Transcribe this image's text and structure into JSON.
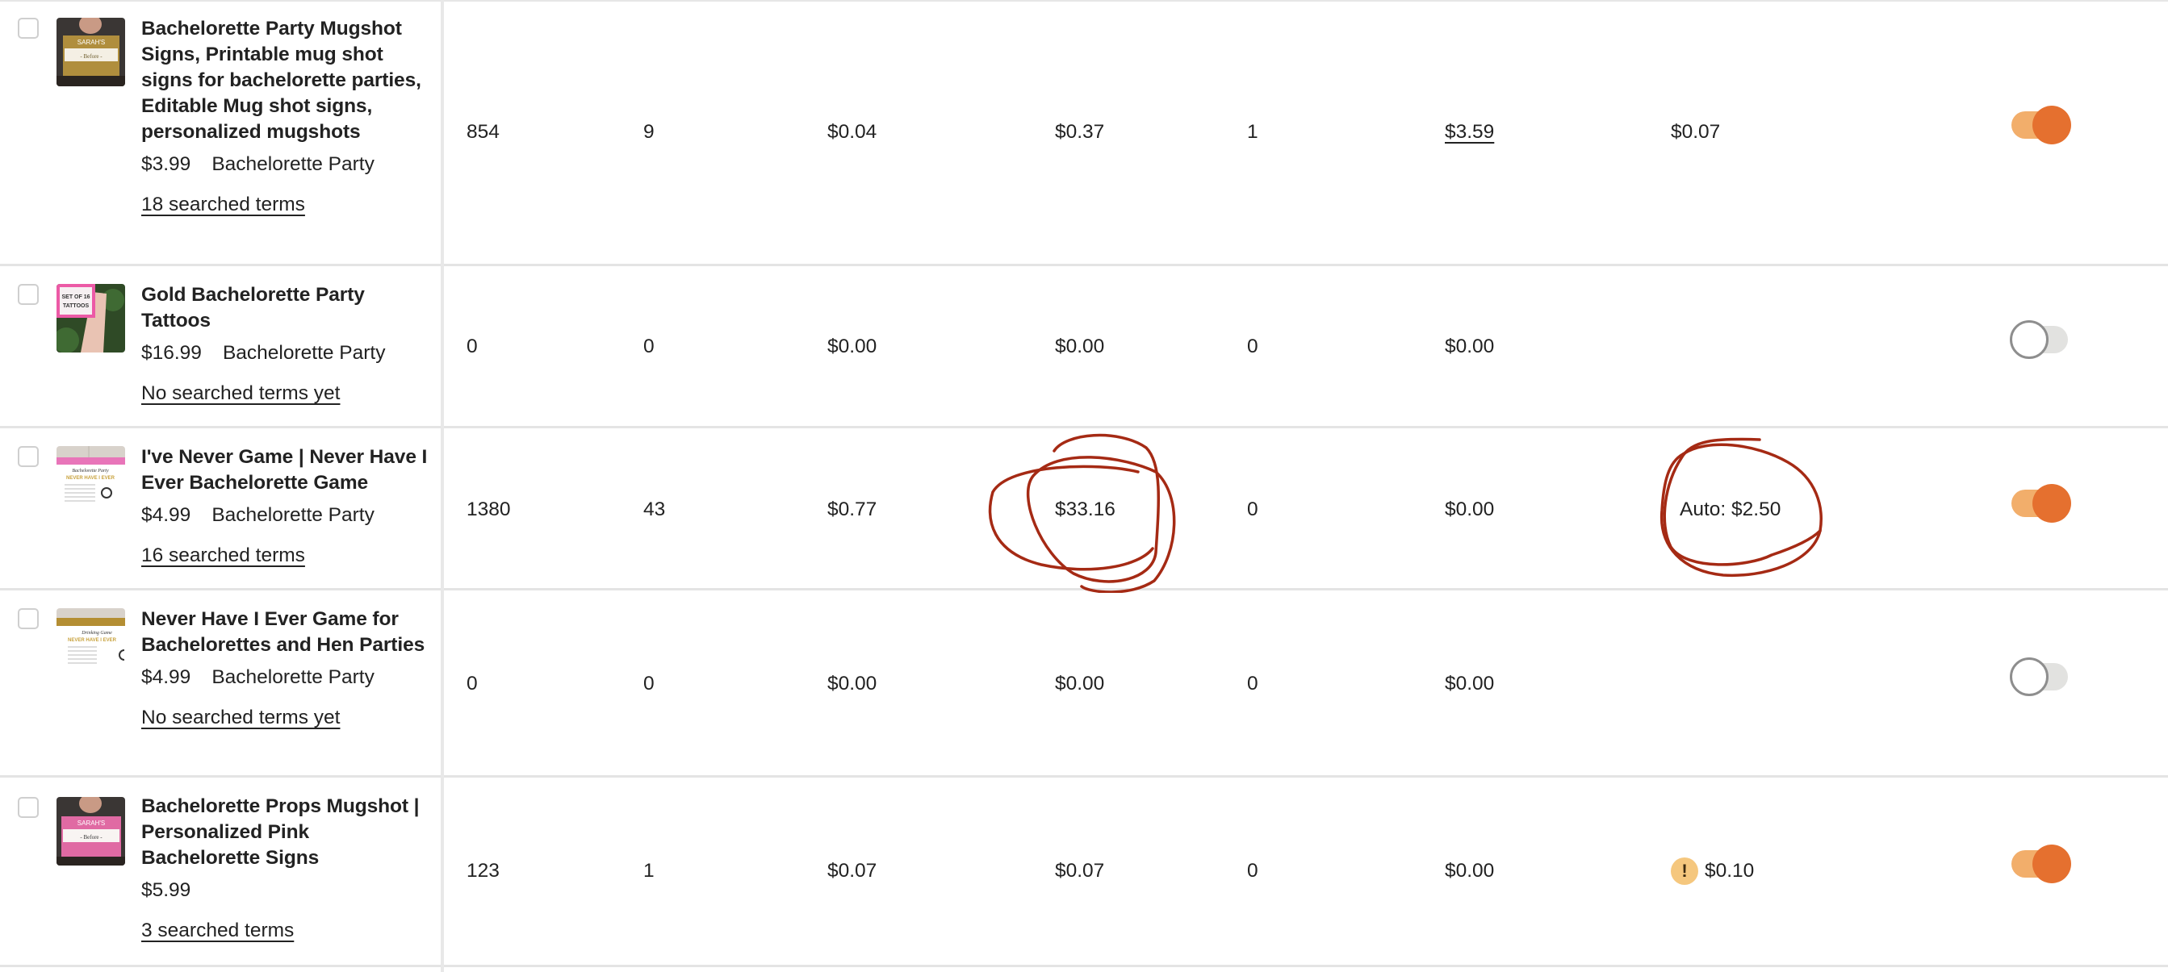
{
  "colors": {
    "toggle_on_track": "#f2ae6b",
    "toggle_on_knob": "#e5702f",
    "toggle_off_track": "#e2e2e0",
    "annotation": "#a52a14",
    "warning_badge": "#f5c77e"
  },
  "listings": [
    {
      "title": "Bachelorette Party Mugshot Signs, Printable mug shot signs for bachelorette parties, Editable Mug shot signs, personalized mugshots",
      "price": "$3.99",
      "section": "Bachelorette Party",
      "searched_terms": "18 searched terms",
      "thumb_icon": "mugshot-sign-gold-thumbnail",
      "views": "854",
      "clicks": "9",
      "col3": "$0.04",
      "col4": "$0.37",
      "orders": "1",
      "revenue": "$3.59",
      "bid": "$0.07",
      "bid_warning": false,
      "active": true
    },
    {
      "title": "Gold Bachelorette Party Tattoos",
      "price": "$16.99",
      "section": "Bachelorette Party",
      "searched_terms": "No searched terms yet",
      "thumb_icon": "tattoos-thumbnail",
      "views": "0",
      "clicks": "0",
      "col3": "$0.00",
      "col4": "$0.00",
      "orders": "0",
      "revenue": "$0.00",
      "bid": "",
      "bid_warning": false,
      "active": false
    },
    {
      "title": "I've Never Game | Never Have I Ever Bachelorette Game",
      "price": "$4.99",
      "section": "Bachelorette Party",
      "searched_terms": "16 searched terms",
      "thumb_icon": "never-have-i-ever-pink-thumbnail",
      "views": "1380",
      "clicks": "43",
      "col3": "$0.77",
      "col4": "$33.16",
      "orders": "0",
      "revenue": "$0.00",
      "bid": "Auto: $2.50",
      "bid_warning": false,
      "active": true
    },
    {
      "title": "Never Have I Ever Game for Bachelorettes and Hen Parties",
      "price": "$4.99",
      "section": "Bachelorette Party",
      "searched_terms": "No searched terms yet",
      "thumb_icon": "never-have-i-ever-gold-thumbnail",
      "views": "0",
      "clicks": "0",
      "col3": "$0.00",
      "col4": "$0.00",
      "orders": "0",
      "revenue": "$0.00",
      "bid": "",
      "bid_warning": false,
      "active": false
    },
    {
      "title": "Bachelorette Props Mugshot | Personalized Pink Bachelorette Signs",
      "price": "$5.99",
      "section": "",
      "searched_terms": "3 searched terms",
      "thumb_icon": "mugshot-sign-pink-thumbnail",
      "views": "123",
      "clicks": "1",
      "col3": "$0.07",
      "col4": "$0.07",
      "orders": "0",
      "revenue": "$0.00",
      "bid": "$0.10",
      "bid_warning": true,
      "warning_icon": "!",
      "active": true
    }
  ],
  "annotations": [
    {
      "type": "hand-drawn-circle",
      "target": "listings.2.col4"
    },
    {
      "type": "hand-drawn-circle",
      "target": "listings.2.bid"
    }
  ]
}
